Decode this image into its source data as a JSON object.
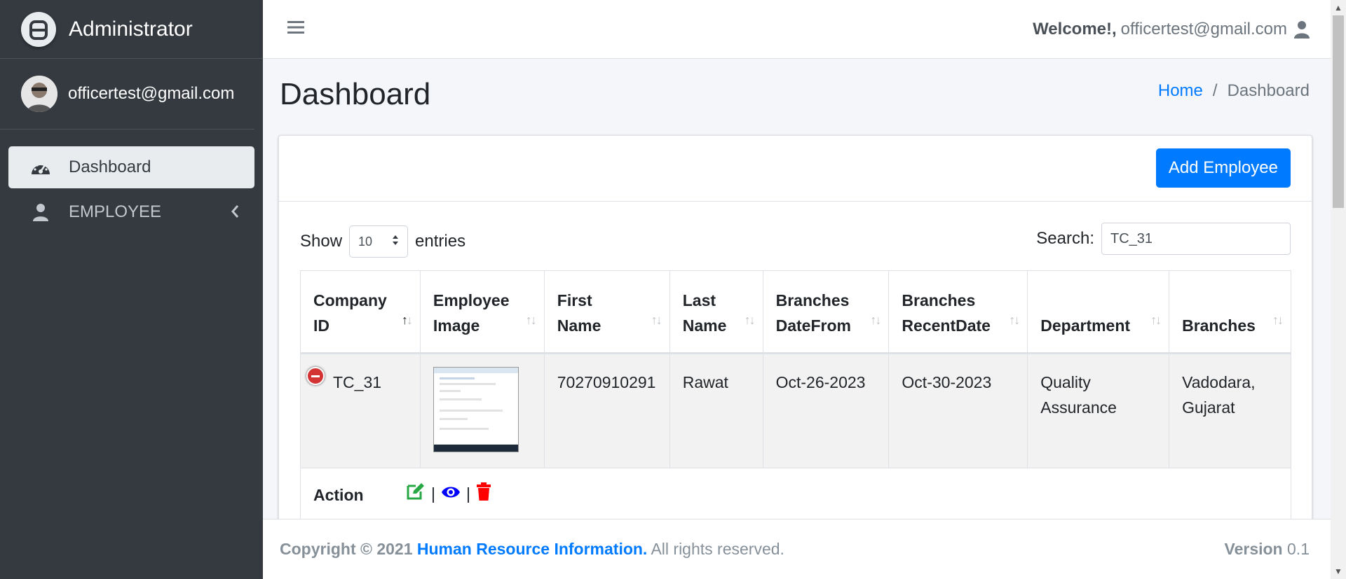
{
  "brand": {
    "title": "Administrator"
  },
  "user": {
    "email": "officertest@gmail.com"
  },
  "sidebar": {
    "items": [
      {
        "label": "Dashboard",
        "icon": "tachometer-icon"
      },
      {
        "label": "EMPLOYEE",
        "icon": "user-icon"
      }
    ]
  },
  "topbar": {
    "welcome_bold": "Welcome!,",
    "welcome_email": "officertest@gmail.com"
  },
  "page": {
    "title": "Dashboard"
  },
  "breadcrumb": {
    "home": "Home",
    "separator": "/",
    "current": "Dashboard"
  },
  "card": {
    "add_button": "Add Employee"
  },
  "table_controls": {
    "show_label": "Show",
    "entries_value": "10",
    "entries_label": "entries",
    "search_label": "Search:",
    "search_value": "TC_31"
  },
  "table": {
    "headers": [
      {
        "line1": "Company",
        "line2": "ID"
      },
      {
        "line1": "Employee",
        "line2": "Image"
      },
      {
        "line1": "First",
        "line2": "Name"
      },
      {
        "line1": "Last",
        "line2": "Name"
      },
      {
        "line1": "Branches",
        "line2": "DateFrom"
      },
      {
        "line1": "Branches",
        "line2": "RecentDate"
      },
      {
        "line1": "",
        "line2": "Department"
      },
      {
        "line1": "",
        "line2": "Branches"
      }
    ],
    "row": {
      "company_id": "TC_31",
      "first_name": "70270910291",
      "last_name": "Rawat",
      "date_from": "Oct-26-2023",
      "recent_date": "Oct-30-2023",
      "department_l1": "Quality",
      "department_l2": "Assurance",
      "branches_l1": "Vadodara,",
      "branches_l2": "Gujarat"
    },
    "child": {
      "action_label": "Action",
      "separator": "|"
    }
  },
  "footer": {
    "copyright": "Copyright © 2021",
    "org": "Human Resource Information.",
    "rights": "All rights reserved.",
    "version_label": "Version",
    "version_value": "0.1"
  },
  "colors": {
    "sidebar_bg": "#343a40",
    "primary": "#007bff",
    "edit": "#28a745",
    "view": "#0000ff",
    "delete": "#ff0000",
    "remove_badge": "#d33333"
  }
}
